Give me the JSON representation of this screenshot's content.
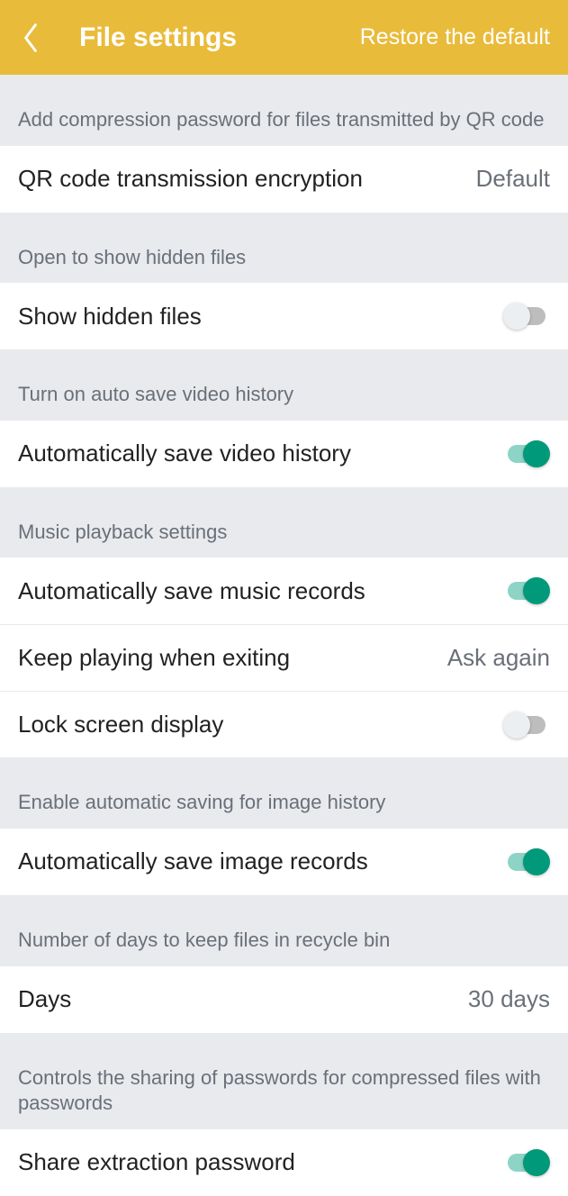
{
  "header": {
    "title": "File settings",
    "restore": "Restore the default"
  },
  "sections": {
    "qr": {
      "header": "Add compression password for files transmitted by QR code",
      "encryption_label": "QR code transmission encryption",
      "encryption_value": "Default"
    },
    "hidden": {
      "header": "Open to show hidden files",
      "show_label": "Show hidden files",
      "show_on": false
    },
    "video": {
      "header": "Turn on auto save video history",
      "auto_label": "Automatically save video history",
      "auto_on": true
    },
    "music": {
      "header": "Music playback settings",
      "auto_label": "Automatically save music records",
      "auto_on": true,
      "keep_label": "Keep playing when exiting",
      "keep_value": "Ask again",
      "lock_label": "Lock screen display",
      "lock_on": false
    },
    "image": {
      "header": "Enable automatic saving for image history",
      "auto_label": "Automatically save image records",
      "auto_on": true
    },
    "recycle": {
      "header": "Number of days to keep files in recycle bin",
      "days_label": "Days",
      "days_value": "30 days"
    },
    "share": {
      "header": "Controls the sharing of passwords for compressed files with passwords",
      "share_label": "Share extraction password",
      "share_on": true
    }
  }
}
